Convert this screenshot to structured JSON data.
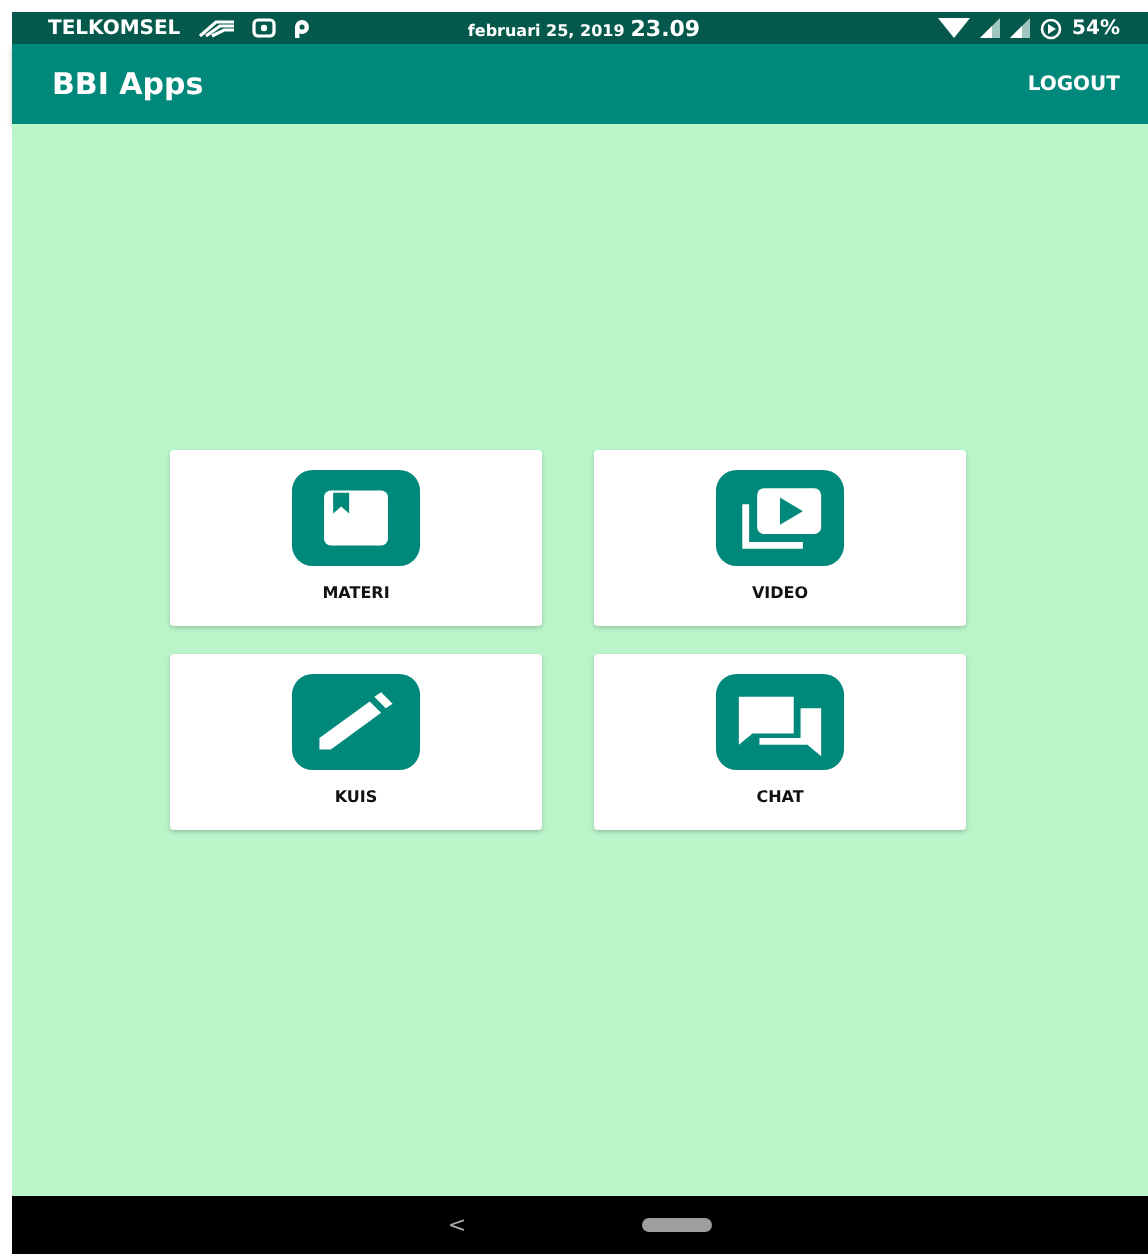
{
  "status_bar": {
    "carrier": "TELKOMSEL",
    "date": "februari 25, 2019",
    "time": "23.09",
    "battery": "54%"
  },
  "app_bar": {
    "title": "BBI Apps",
    "action": "LOGOUT"
  },
  "tiles": [
    {
      "label": "MATERI",
      "kind": "book"
    },
    {
      "label": "VIDEO",
      "kind": "video"
    },
    {
      "label": "KUIS",
      "kind": "pencil"
    },
    {
      "label": "CHAT",
      "kind": "chat"
    }
  ],
  "nav_bar": {
    "back": "<"
  }
}
